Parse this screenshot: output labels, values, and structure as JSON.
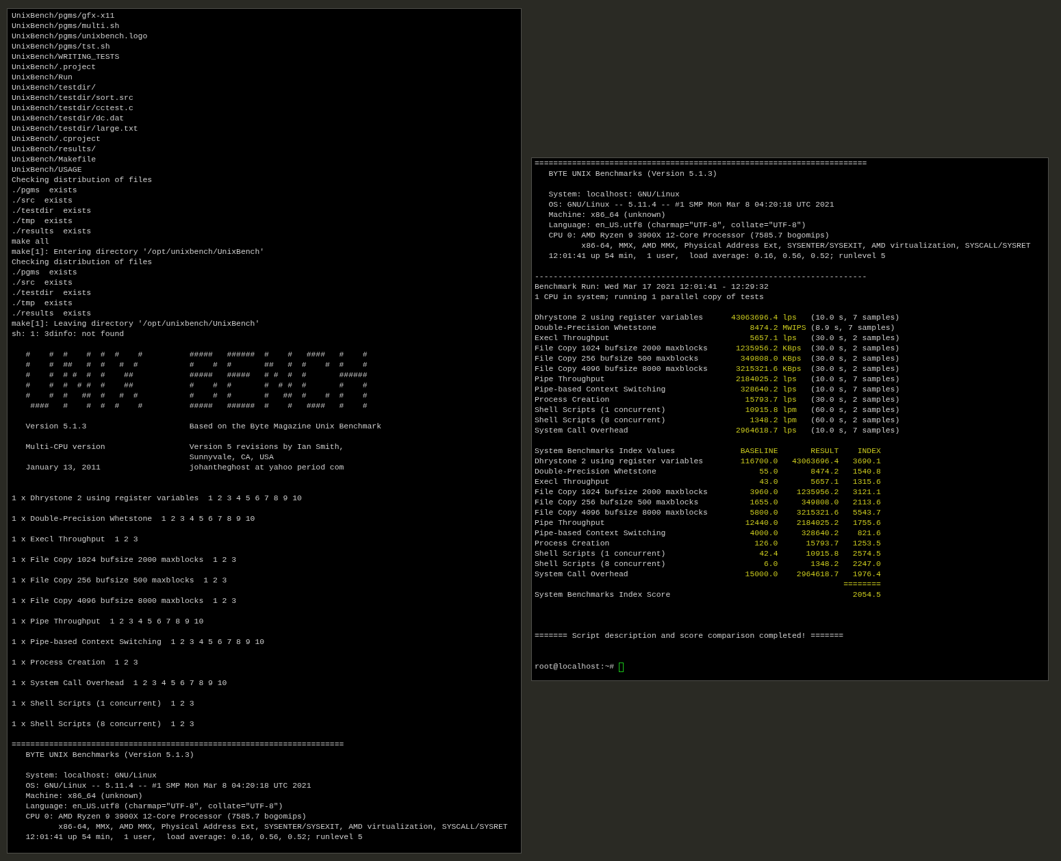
{
  "left_terminal": {
    "lines": [
      {
        "kind": "text",
        "text": "UnixBench/pgms/gfx-x11"
      },
      {
        "kind": "text",
        "text": "UnixBench/pgms/multi.sh"
      },
      {
        "kind": "text",
        "text": "UnixBench/pgms/unixbench.logo"
      },
      {
        "kind": "text",
        "text": "UnixBench/pgms/tst.sh"
      },
      {
        "kind": "text",
        "text": "UnixBench/WRITING_TESTS"
      },
      {
        "kind": "text",
        "text": "UnixBench/.project"
      },
      {
        "kind": "text",
        "text": "UnixBench/Run"
      },
      {
        "kind": "text",
        "text": "UnixBench/testdir/"
      },
      {
        "kind": "text",
        "text": "UnixBench/testdir/sort.src"
      },
      {
        "kind": "text",
        "text": "UnixBench/testdir/cctest.c"
      },
      {
        "kind": "text",
        "text": "UnixBench/testdir/dc.dat"
      },
      {
        "kind": "text",
        "text": "UnixBench/testdir/large.txt"
      },
      {
        "kind": "text",
        "text": "UnixBench/.cproject"
      },
      {
        "kind": "text",
        "text": "UnixBench/results/"
      },
      {
        "kind": "text",
        "text": "UnixBench/Makefile"
      },
      {
        "kind": "text",
        "text": "UnixBench/USAGE"
      },
      {
        "kind": "text",
        "text": "Checking distribution of files"
      },
      {
        "kind": "text",
        "text": "./pgms  exists"
      },
      {
        "kind": "text",
        "text": "./src  exists"
      },
      {
        "kind": "text",
        "text": "./testdir  exists"
      },
      {
        "kind": "text",
        "text": "./tmp  exists"
      },
      {
        "kind": "text",
        "text": "./results  exists"
      },
      {
        "kind": "text",
        "text": "make all"
      },
      {
        "kind": "text",
        "text": "make[1]: Entering directory '/opt/unixbench/UnixBench'"
      },
      {
        "kind": "text",
        "text": "Checking distribution of files"
      },
      {
        "kind": "text",
        "text": "./pgms  exists"
      },
      {
        "kind": "text",
        "text": "./src  exists"
      },
      {
        "kind": "text",
        "text": "./testdir  exists"
      },
      {
        "kind": "text",
        "text": "./tmp  exists"
      },
      {
        "kind": "text",
        "text": "./results  exists"
      },
      {
        "kind": "text",
        "text": "make[1]: Leaving directory '/opt/unixbench/UnixBench'"
      },
      {
        "kind": "text",
        "text": "sh: 1: 3dinfo: not found"
      },
      {
        "kind": "blank"
      },
      {
        "kind": "text",
        "text": "   #    #  #    #  #  #    #          #####   ######  #    #   ####   #    #"
      },
      {
        "kind": "text",
        "text": "   #    #  ##   #  #   #  #           #    #  #       ##   #  #    #  #    #"
      },
      {
        "kind": "text",
        "text": "   #    #  # #  #  #    ##            #####   #####   # #  #  #       ######"
      },
      {
        "kind": "text",
        "text": "   #    #  #  # #  #    ##            #    #  #       #  # #  #       #    #"
      },
      {
        "kind": "text",
        "text": "   #    #  #   ##  #   #  #           #    #  #       #   ##  #    #  #    #"
      },
      {
        "kind": "text",
        "text": "    ####   #    #  #  #    #          #####   ######  #    #   ####   #    #"
      },
      {
        "kind": "blank"
      },
      {
        "kind": "text",
        "text": "   Version 5.1.3                      Based on the Byte Magazine Unix Benchmark"
      },
      {
        "kind": "blank"
      },
      {
        "kind": "text",
        "text": "   Multi-CPU version                  Version 5 revisions by Ian Smith,"
      },
      {
        "kind": "text",
        "text": "                                      Sunnyvale, CA, USA"
      },
      {
        "kind": "text",
        "text": "   January 13, 2011                   johantheghost at yahoo period com"
      },
      {
        "kind": "blank"
      },
      {
        "kind": "blank"
      },
      {
        "kind": "text",
        "text": "1 x Dhrystone 2 using register variables  1 2 3 4 5 6 7 8 9 10"
      },
      {
        "kind": "blank"
      },
      {
        "kind": "text",
        "text": "1 x Double-Precision Whetstone  1 2 3 4 5 6 7 8 9 10"
      },
      {
        "kind": "blank"
      },
      {
        "kind": "text",
        "text": "1 x Execl Throughput  1 2 3"
      },
      {
        "kind": "blank"
      },
      {
        "kind": "text",
        "text": "1 x File Copy 1024 bufsize 2000 maxblocks  1 2 3"
      },
      {
        "kind": "blank"
      },
      {
        "kind": "text",
        "text": "1 x File Copy 256 bufsize 500 maxblocks  1 2 3"
      },
      {
        "kind": "blank"
      },
      {
        "kind": "text",
        "text": "1 x File Copy 4096 bufsize 8000 maxblocks  1 2 3"
      },
      {
        "kind": "blank"
      },
      {
        "kind": "text",
        "text": "1 x Pipe Throughput  1 2 3 4 5 6 7 8 9 10"
      },
      {
        "kind": "blank"
      },
      {
        "kind": "text",
        "text": "1 x Pipe-based Context Switching  1 2 3 4 5 6 7 8 9 10"
      },
      {
        "kind": "blank"
      },
      {
        "kind": "text",
        "text": "1 x Process Creation  1 2 3"
      },
      {
        "kind": "blank"
      },
      {
        "kind": "text",
        "text": "1 x System Call Overhead  1 2 3 4 5 6 7 8 9 10"
      },
      {
        "kind": "blank"
      },
      {
        "kind": "text",
        "text": "1 x Shell Scripts (1 concurrent)  1 2 3"
      },
      {
        "kind": "blank"
      },
      {
        "kind": "text",
        "text": "1 x Shell Scripts (8 concurrent)  1 2 3"
      },
      {
        "kind": "blank"
      },
      {
        "kind": "text",
        "text": "======================================================================="
      },
      {
        "kind": "text",
        "text": "   BYTE UNIX Benchmarks (Version 5.1.3)"
      },
      {
        "kind": "blank"
      },
      {
        "kind": "text",
        "text": "   System: localhost: GNU/Linux"
      },
      {
        "kind": "text",
        "text": "   OS: GNU/Linux -- 5.11.4 -- #1 SMP Mon Mar 8 04:20:18 UTC 2021"
      },
      {
        "kind": "text",
        "text": "   Machine: x86_64 (unknown)"
      },
      {
        "kind": "text",
        "text": "   Language: en_US.utf8 (charmap=\"UTF-8\", collate=\"UTF-8\")"
      },
      {
        "kind": "text",
        "text": "   CPU 0: AMD Ryzen 9 3900X 12-Core Processor (7585.7 bogomips)"
      },
      {
        "kind": "text",
        "text": "          x86-64, MMX, AMD MMX, Physical Address Ext, SYSENTER/SYSEXIT, AMD virtualization, SYSCALL/SYSRET"
      },
      {
        "kind": "text",
        "text": "   12:01:41 up 54 min,  1 user,  load average: 0.16, 0.56, 0.52; runlevel 5"
      }
    ]
  },
  "right_terminal": {
    "header_lines": [
      {
        "kind": "text",
        "text": "======================================================================="
      },
      {
        "kind": "text",
        "text": "   BYTE UNIX Benchmarks (Version 5.1.3)"
      },
      {
        "kind": "blank"
      },
      {
        "kind": "text",
        "text": "   System: localhost: GNU/Linux"
      },
      {
        "kind": "text",
        "text": "   OS: GNU/Linux -- 5.11.4 -- #1 SMP Mon Mar 8 04:20:18 UTC 2021"
      },
      {
        "kind": "text",
        "text": "   Machine: x86_64 (unknown)"
      },
      {
        "kind": "text",
        "text": "   Language: en_US.utf8 (charmap=\"UTF-8\", collate=\"UTF-8\")"
      },
      {
        "kind": "text",
        "text": "   CPU 0: AMD Ryzen 9 3900X 12-Core Processor (7585.7 bogomips)"
      },
      {
        "kind": "text",
        "text": "          x86-64, MMX, AMD MMX, Physical Address Ext, SYSENTER/SYSEXIT, AMD virtualization, SYSCALL/SYSRET"
      },
      {
        "kind": "text",
        "text": "   12:01:41 up 54 min,  1 user,  load average: 0.16, 0.56, 0.52; runlevel 5"
      },
      {
        "kind": "blank"
      },
      {
        "kind": "text",
        "text": "-----------------------------------------------------------------------"
      },
      {
        "kind": "text",
        "text": "Benchmark Run: Wed Mar 17 2021 12:01:41 - 12:29:32"
      },
      {
        "kind": "text",
        "text": "1 CPU in system; running 1 parallel copy of tests"
      },
      {
        "kind": "blank"
      }
    ],
    "results": [
      {
        "name": "Dhrystone 2 using register variables",
        "value": "43063696.4",
        "unit": "lps",
        "timing": "(10.0 s, 7 samples)"
      },
      {
        "name": "Double-Precision Whetstone",
        "value": "8474.2",
        "unit": "MWIPS",
        "timing": "(8.9 s, 7 samples)"
      },
      {
        "name": "Execl Throughput",
        "value": "5657.1",
        "unit": "lps",
        "timing": "(30.0 s, 2 samples)"
      },
      {
        "name": "File Copy 1024 bufsize 2000 maxblocks",
        "value": "1235956.2",
        "unit": "KBps",
        "timing": "(30.0 s, 2 samples)"
      },
      {
        "name": "File Copy 256 bufsize 500 maxblocks",
        "value": "349808.0",
        "unit": "KBps",
        "timing": "(30.0 s, 2 samples)"
      },
      {
        "name": "File Copy 4096 bufsize 8000 maxblocks",
        "value": "3215321.6",
        "unit": "KBps",
        "timing": "(30.0 s, 2 samples)"
      },
      {
        "name": "Pipe Throughput",
        "value": "2184025.2",
        "unit": "lps",
        "timing": "(10.0 s, 7 samples)"
      },
      {
        "name": "Pipe-based Context Switching",
        "value": "328640.2",
        "unit": "lps",
        "timing": "(10.0 s, 7 samples)"
      },
      {
        "name": "Process Creation",
        "value": "15793.7",
        "unit": "lps",
        "timing": "(30.0 s, 2 samples)"
      },
      {
        "name": "Shell Scripts (1 concurrent)",
        "value": "10915.8",
        "unit": "lpm",
        "timing": "(60.0 s, 2 samples)"
      },
      {
        "name": "Shell Scripts (8 concurrent)",
        "value": "1348.2",
        "unit": "lpm",
        "timing": "(60.0 s, 2 samples)"
      },
      {
        "name": "System Call Overhead",
        "value": "2964618.7",
        "unit": "lps",
        "timing": "(10.0 s, 7 samples)"
      }
    ],
    "index_table": {
      "title": "System Benchmarks Index Values",
      "columns": [
        "BASELINE",
        "RESULT",
        "INDEX"
      ],
      "rows": [
        {
          "name": "Dhrystone 2 using register variables",
          "baseline": "116700.0",
          "result": "43063696.4",
          "index": "3690.1"
        },
        {
          "name": "Double-Precision Whetstone",
          "baseline": "55.0",
          "result": "8474.2",
          "index": "1540.8"
        },
        {
          "name": "Execl Throughput",
          "baseline": "43.0",
          "result": "5657.1",
          "index": "1315.6"
        },
        {
          "name": "File Copy 1024 bufsize 2000 maxblocks",
          "baseline": "3960.0",
          "result": "1235956.2",
          "index": "3121.1"
        },
        {
          "name": "File Copy 256 bufsize 500 maxblocks",
          "baseline": "1655.0",
          "result": "349808.0",
          "index": "2113.6"
        },
        {
          "name": "File Copy 4096 bufsize 8000 maxblocks",
          "baseline": "5800.0",
          "result": "3215321.6",
          "index": "5543.7"
        },
        {
          "name": "Pipe Throughput",
          "baseline": "12440.0",
          "result": "2184025.2",
          "index": "1755.6"
        },
        {
          "name": "Pipe-based Context Switching",
          "baseline": "4000.0",
          "result": "328640.2",
          "index": "821.6"
        },
        {
          "name": "Process Creation",
          "baseline": "126.0",
          "result": "15793.7",
          "index": "1253.5"
        },
        {
          "name": "Shell Scripts (1 concurrent)",
          "baseline": "42.4",
          "result": "10915.8",
          "index": "2574.5"
        },
        {
          "name": "Shell Scripts (8 concurrent)",
          "baseline": "6.0",
          "result": "1348.2",
          "index": "2247.0"
        },
        {
          "name": "System Call Overhead",
          "baseline": "15000.0",
          "result": "2964618.7",
          "index": "1976.4"
        }
      ],
      "separator": "========",
      "score_label": "System Benchmarks Index Score",
      "score": "2054.5"
    },
    "footer_lines": [
      {
        "kind": "blank"
      },
      {
        "kind": "blank"
      },
      {
        "kind": "blank"
      },
      {
        "kind": "text",
        "text": "======= Script description and score comparison completed! ======="
      },
      {
        "kind": "blank"
      },
      {
        "kind": "blank"
      }
    ],
    "prompt": "root@localhost:~#"
  }
}
